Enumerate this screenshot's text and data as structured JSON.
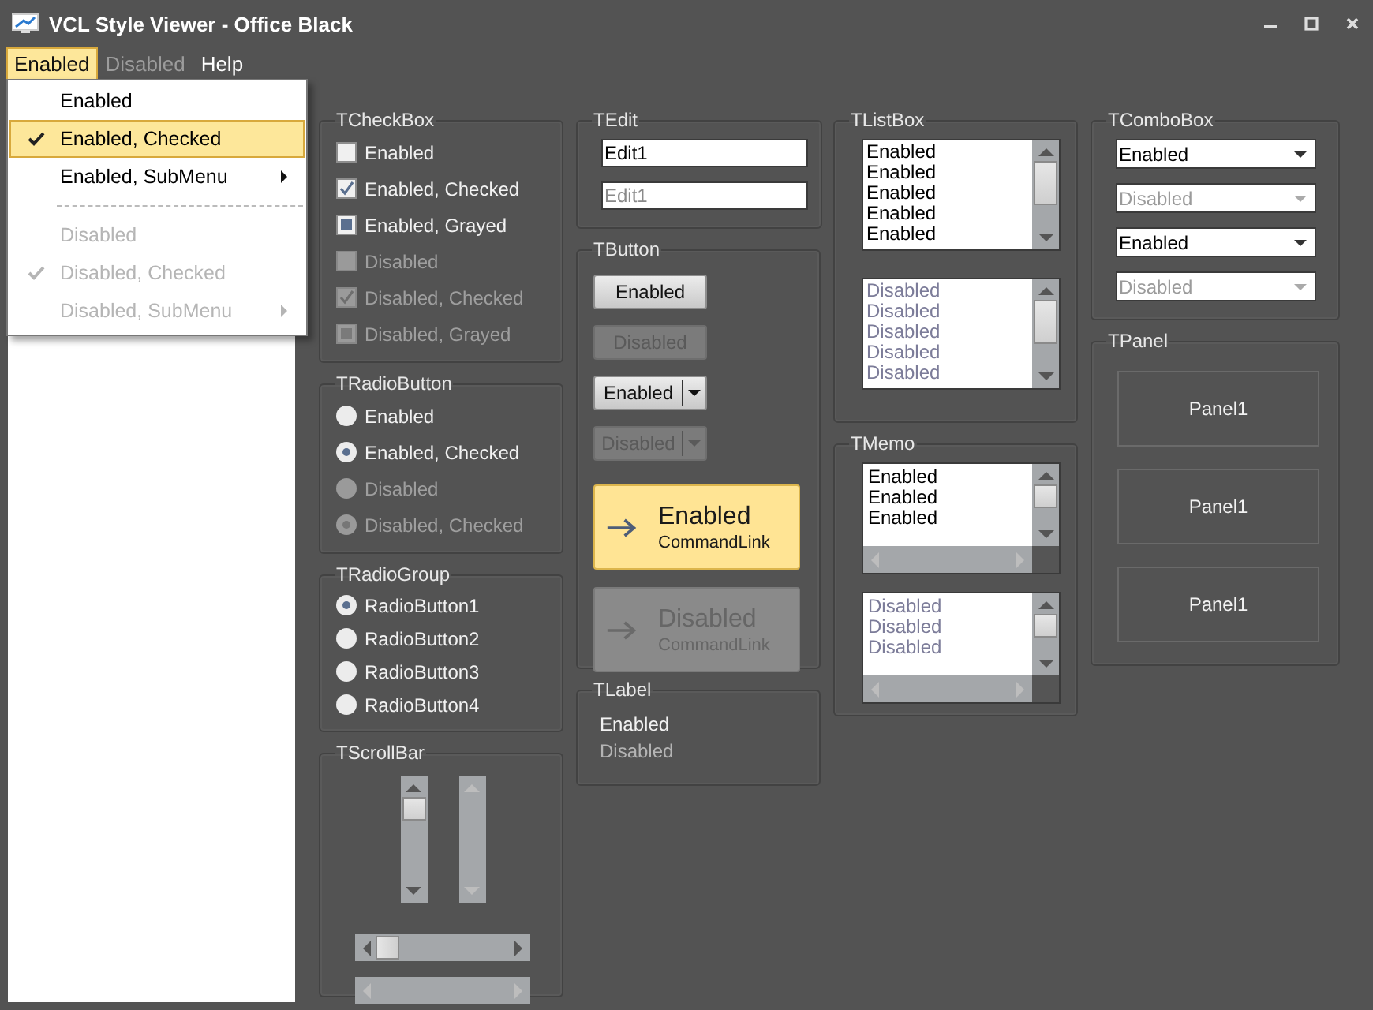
{
  "window": {
    "title": "VCL Style Viewer - Office Black"
  },
  "menu_bar": [
    {
      "label": "Enabled",
      "selected": true,
      "disabled": false
    },
    {
      "label": "Disabled",
      "selected": false,
      "disabled": true
    },
    {
      "label": "Help",
      "selected": false,
      "disabled": false
    }
  ],
  "menu_dropdown": [
    {
      "kind": "item",
      "label": "Enabled",
      "checked": false,
      "disabled": false,
      "submenu": false,
      "selected": false
    },
    {
      "kind": "item",
      "label": "Enabled, Checked",
      "checked": true,
      "disabled": false,
      "submenu": false,
      "selected": true
    },
    {
      "kind": "item",
      "label": "Enabled, SubMenu",
      "checked": false,
      "disabled": false,
      "submenu": true,
      "selected": false
    },
    {
      "kind": "separator"
    },
    {
      "kind": "item",
      "label": "Disabled",
      "checked": false,
      "disabled": true,
      "submenu": false,
      "selected": false
    },
    {
      "kind": "item",
      "label": "Disabled, Checked",
      "checked": true,
      "disabled": true,
      "submenu": false,
      "selected": false
    },
    {
      "kind": "item",
      "label": "Disabled, SubMenu",
      "checked": false,
      "disabled": true,
      "submenu": true,
      "selected": false
    }
  ],
  "checkbox_group": {
    "title": "TCheckBox",
    "items": [
      {
        "label": "Enabled",
        "checked": false,
        "grayed": false,
        "disabled": false
      },
      {
        "label": "Enabled, Checked",
        "checked": true,
        "grayed": false,
        "disabled": false
      },
      {
        "label": "Enabled, Grayed",
        "checked": false,
        "grayed": true,
        "disabled": false
      },
      {
        "label": "Disabled",
        "checked": false,
        "grayed": false,
        "disabled": true
      },
      {
        "label": "Disabled, Checked",
        "checked": true,
        "grayed": false,
        "disabled": true
      },
      {
        "label": "Disabled, Grayed",
        "checked": false,
        "grayed": true,
        "disabled": true
      }
    ]
  },
  "radio_button_group": {
    "title": "TRadioButton",
    "items": [
      {
        "label": "Enabled",
        "selected": false,
        "disabled": false
      },
      {
        "label": "Enabled, Checked",
        "selected": true,
        "disabled": false
      },
      {
        "label": "Disabled",
        "selected": false,
        "disabled": true
      },
      {
        "label": "Disabled, Checked",
        "selected": true,
        "disabled": true
      }
    ]
  },
  "radio_group": {
    "title": "TRadioGroup",
    "items": [
      {
        "label": "RadioButton1",
        "selected": true
      },
      {
        "label": "RadioButton2",
        "selected": false
      },
      {
        "label": "RadioButton3",
        "selected": false
      },
      {
        "label": "RadioButton4",
        "selected": false
      }
    ]
  },
  "scrollbar_group": {
    "title": "TScrollBar",
    "scrollbars": [
      {
        "kind": "vertical",
        "disabled": false
      },
      {
        "kind": "vertical",
        "disabled": true
      },
      {
        "kind": "horizontal",
        "disabled": false
      },
      {
        "kind": "horizontal",
        "disabled": true
      }
    ]
  },
  "edit_group": {
    "title": "TEdit",
    "fields": [
      {
        "value": "Edit1",
        "disabled": false
      },
      {
        "value": "Edit1",
        "disabled": true
      }
    ]
  },
  "button_group": {
    "title": "TButton",
    "buttons": [
      {
        "kind": "button",
        "label": "Enabled",
        "disabled": false
      },
      {
        "kind": "button",
        "label": "Disabled",
        "disabled": true
      },
      {
        "kind": "split",
        "label": "Enabled",
        "disabled": false
      },
      {
        "kind": "split",
        "label": "Disabled",
        "disabled": true
      },
      {
        "kind": "command_link",
        "label": "Enabled",
        "note": "CommandLink",
        "disabled": false
      },
      {
        "kind": "command_link",
        "label": "Disabled",
        "note": "CommandLink",
        "disabled": true
      }
    ]
  },
  "label_group": {
    "title": "TLabel",
    "labels": [
      {
        "text": "Enabled",
        "disabled": false
      },
      {
        "text": "Disabled",
        "disabled": true
      }
    ]
  },
  "listbox_group": {
    "title": "TListBox",
    "listboxes": [
      {
        "disabled": false,
        "items": [
          "Enabled",
          "Enabled",
          "Enabled",
          "Enabled",
          "Enabled"
        ]
      },
      {
        "disabled": true,
        "items": [
          "Disabled",
          "Disabled",
          "Disabled",
          "Disabled",
          "Disabled"
        ]
      }
    ]
  },
  "memo_group": {
    "title": "TMemo",
    "memos": [
      {
        "disabled": false,
        "lines": [
          "Enabled",
          "Enabled",
          "Enabled"
        ]
      },
      {
        "disabled": true,
        "lines": [
          "Disabled",
          "Disabled",
          "Disabled"
        ]
      }
    ]
  },
  "combobox_group": {
    "title": "TComboBox",
    "comboboxes": [
      {
        "value": "Enabled",
        "disabled": false
      },
      {
        "value": "Disabled",
        "disabled": true
      },
      {
        "value": "Enabled",
        "disabled": false
      },
      {
        "value": "Disabled",
        "disabled": true
      }
    ]
  },
  "panel_group": {
    "title": "TPanel",
    "panels": [
      {
        "label": "Panel1"
      },
      {
        "label": "Panel1"
      },
      {
        "label": "Panel1"
      }
    ]
  }
}
